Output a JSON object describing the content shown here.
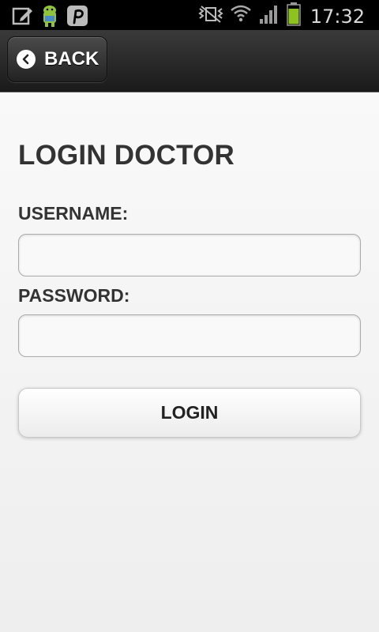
{
  "status_bar": {
    "time": "17:32",
    "left_icons": [
      "edit-note-icon",
      "android-icon",
      "pinterest-icon"
    ],
    "right_icons": [
      "vibrate-icon",
      "wifi-icon",
      "signal-icon",
      "battery-icon"
    ],
    "battery_color": "#8dc21f"
  },
  "header": {
    "back_label": "BACK"
  },
  "main": {
    "title": "LOGIN DOCTOR",
    "username_label": "USERNAME:",
    "username_value": "",
    "password_label": "PASSWORD:",
    "password_value": "",
    "login_label": "LOGIN"
  }
}
